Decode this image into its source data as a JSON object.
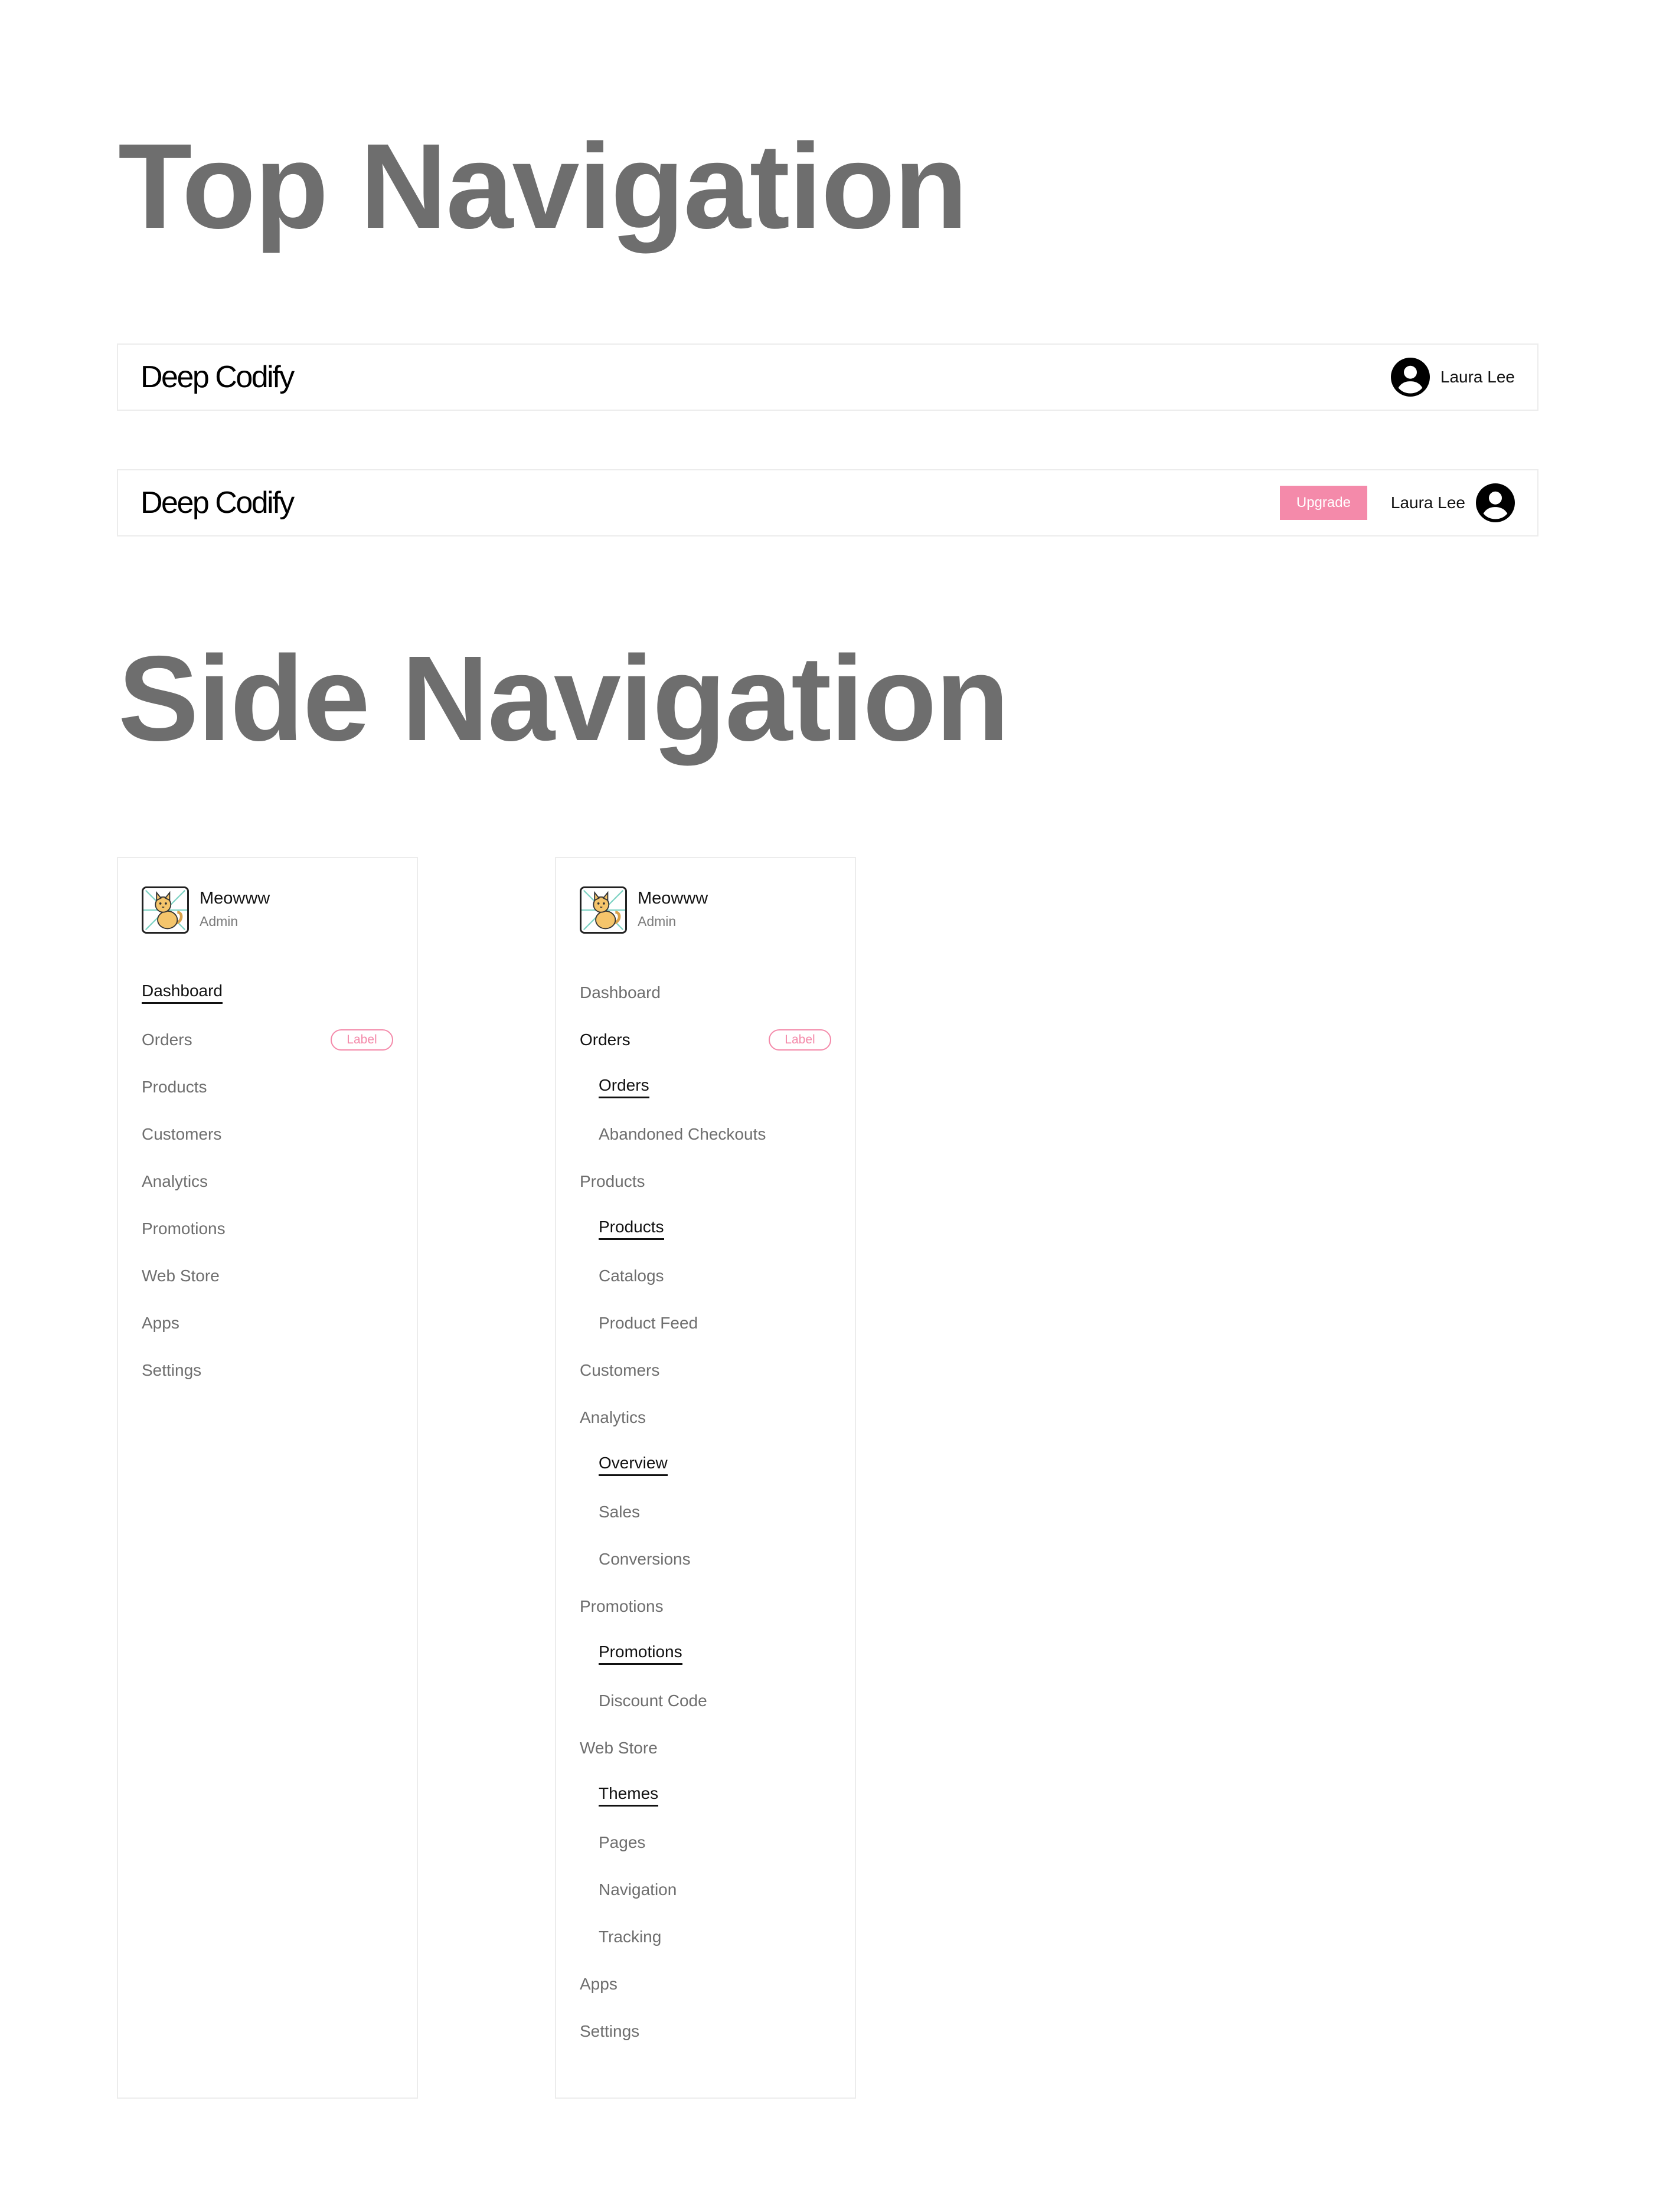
{
  "top_section": {
    "title": "Top Navigation",
    "bar1": {
      "brand": "Deep Codify",
      "user_name": "Laura Lee"
    },
    "bar2": {
      "brand": "Deep Codify",
      "upgrade_label": "Upgrade",
      "user_name": "Laura Lee"
    }
  },
  "side_section": {
    "title": "Side Navigation",
    "nav1": {
      "profile": {
        "name": "Meowww",
        "role": "Admin"
      },
      "items": [
        {
          "label": "Dashboard",
          "active": true
        },
        {
          "label": "Orders",
          "badge": "Label"
        },
        {
          "label": "Products"
        },
        {
          "label": "Customers"
        },
        {
          "label": "Analytics"
        },
        {
          "label": "Promotions"
        },
        {
          "label": "Web Store"
        },
        {
          "label": "Apps"
        },
        {
          "label": "Settings"
        }
      ]
    },
    "nav2": {
      "profile": {
        "name": "Meowww",
        "role": "Admin"
      },
      "items": [
        {
          "label": "Dashboard"
        },
        {
          "label": "Orders",
          "badge": "Label",
          "open": true
        },
        {
          "label": "Orders",
          "sub": true,
          "active": true
        },
        {
          "label": "Abandoned Checkouts",
          "sub": true
        },
        {
          "label": "Products"
        },
        {
          "label": "Products",
          "sub": true,
          "active": true
        },
        {
          "label": "Catalogs",
          "sub": true
        },
        {
          "label": "Product Feed",
          "sub": true
        },
        {
          "label": "Customers"
        },
        {
          "label": "Analytics"
        },
        {
          "label": "Overview",
          "sub": true,
          "active": true
        },
        {
          "label": "Sales",
          "sub": true
        },
        {
          "label": "Conversions",
          "sub": true
        },
        {
          "label": "Promotions"
        },
        {
          "label": "Promotions",
          "sub": true,
          "active": true
        },
        {
          "label": "Discount Code",
          "sub": true
        },
        {
          "label": "Web Store"
        },
        {
          "label": "Themes",
          "sub": true,
          "active": true
        },
        {
          "label": "Pages",
          "sub": true
        },
        {
          "label": "Navigation",
          "sub": true
        },
        {
          "label": "Tracking",
          "sub": true
        },
        {
          "label": "Apps"
        },
        {
          "label": "Settings"
        }
      ]
    }
  },
  "icons": {
    "avatar": "user-circle-icon",
    "profile_image": "cat-avatar-icon"
  },
  "colors": {
    "accent": "#f48aaa",
    "title": "#6e6e6e",
    "muted_text": "#6e6e6e",
    "active_text": "#111111",
    "border": "#ececec"
  }
}
